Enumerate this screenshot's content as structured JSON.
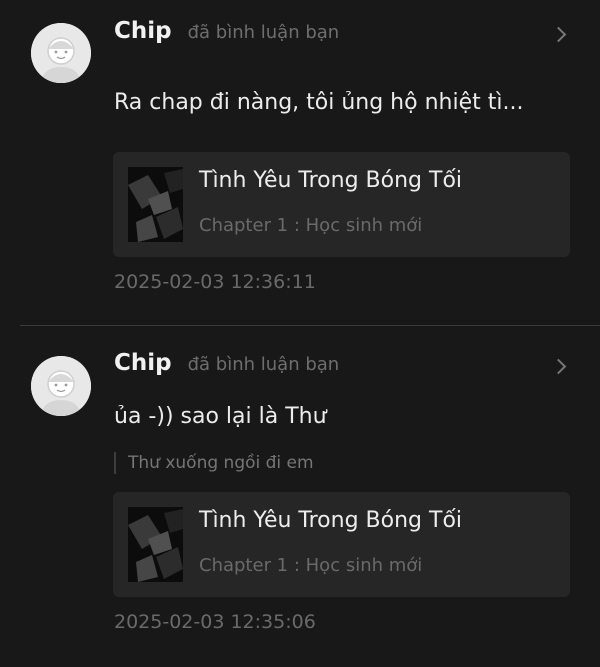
{
  "notifications": [
    {
      "user": "Chip",
      "action": "đã bình luận bạn",
      "comment": "Ra chap đi nàng, tôi ủng hộ nhiệt tì...",
      "story_title": "Tình Yêu Trong Bóng Tối",
      "chapter": "Chapter 1 : Học sinh mới",
      "time": "2025-02-03 12:36:11"
    },
    {
      "user": "Chip",
      "action": "đã bình luận bạn",
      "comment": "ủa -)) sao lại là Thư",
      "quote": "Thư xuống ngồi đi em",
      "story_title": "Tình Yêu Trong Bóng Tối",
      "chapter": "Chapter 1 : Học sinh mới",
      "time": "2025-02-03 12:35:06"
    }
  ],
  "icons": {
    "avatar": "default-user-avatar-icon",
    "chevron": "chevron-right-icon"
  },
  "colors": {
    "background": "#181818",
    "card": "#262626",
    "muted_text": "#6a6a6a",
    "primary_text": "#ececec"
  }
}
